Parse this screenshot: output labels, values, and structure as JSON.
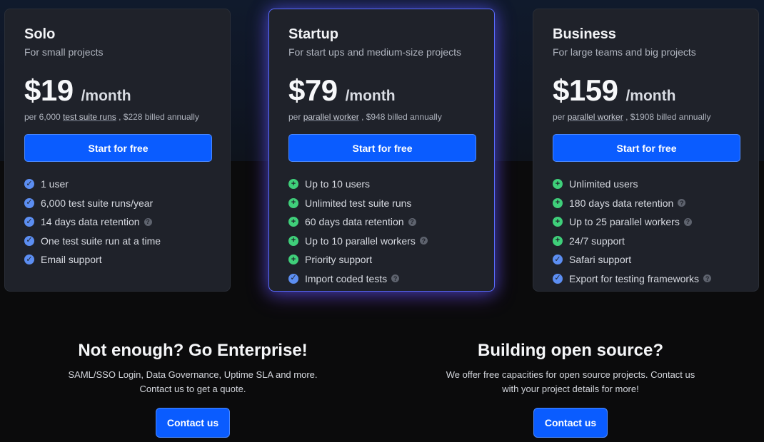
{
  "plans": [
    {
      "name": "Solo",
      "subtitle": "For small projects",
      "price": "$19",
      "per": "/month",
      "billing_prefix": "per 6,000",
      "billing_link": "test suite runs",
      "billing_suffix": ", $228 billed annually",
      "cta": "Start for free",
      "features": [
        {
          "icon": "check-circle-icon",
          "text": "1 user",
          "help": false
        },
        {
          "icon": "check-circle-icon",
          "text": "6,000 test suite runs/year",
          "help": false
        },
        {
          "icon": "check-circle-icon",
          "text": "14 days data retention",
          "help": true
        },
        {
          "icon": "check-circle-icon",
          "text": "One test suite run at a time",
          "help": false
        },
        {
          "icon": "check-circle-icon",
          "text": "Email support",
          "help": false
        }
      ]
    },
    {
      "name": "Startup",
      "subtitle": "For start ups and medium-size projects",
      "price": "$79",
      "per": "/month",
      "billing_prefix": "per",
      "billing_link": "parallel worker",
      "billing_suffix": ", $948 billed annually",
      "cta": "Start for free",
      "features": [
        {
          "icon": "plus-circle-icon",
          "text": "Up to 10 users",
          "help": false
        },
        {
          "icon": "plus-circle-icon",
          "text": "Unlimited test suite runs",
          "help": false
        },
        {
          "icon": "plus-circle-icon",
          "text": "60 days data retention",
          "help": true
        },
        {
          "icon": "plus-circle-icon",
          "text": "Up to 10 parallel workers",
          "help": true
        },
        {
          "icon": "plus-circle-icon",
          "text": "Priority support",
          "help": false
        },
        {
          "icon": "check-circle-icon",
          "text": "Import coded tests",
          "help": true
        }
      ]
    },
    {
      "name": "Business",
      "subtitle": "For large teams and big projects",
      "price": "$159",
      "per": "/month",
      "billing_prefix": "per",
      "billing_link": "parallel worker",
      "billing_suffix": ", $1908 billed annually",
      "cta": "Start for free",
      "features": [
        {
          "icon": "plus-circle-icon",
          "text": "Unlimited users",
          "help": false
        },
        {
          "icon": "plus-circle-icon",
          "text": "180 days data retention",
          "help": true
        },
        {
          "icon": "plus-circle-icon",
          "text": "Up to 25 parallel workers",
          "help": true
        },
        {
          "icon": "plus-circle-icon",
          "text": "24/7 support",
          "help": false
        },
        {
          "icon": "check-circle-icon",
          "text": "Safari support",
          "help": false
        },
        {
          "icon": "check-circle-icon",
          "text": "Export for testing frameworks",
          "help": true
        }
      ]
    }
  ],
  "enterprise": {
    "title": "Not enough? Go Enterprise!",
    "line1": "SAML/SSO Login, Data Governance, Uptime SLA and more.",
    "line2": "Contact us to get a quote.",
    "button": "Contact us"
  },
  "open_source": {
    "title": "Building open source?",
    "line1": "We offer free capacities for open source projects. Contact us",
    "line2": "with your project details for more!",
    "button": "Contact us"
  },
  "colors": {
    "accent": "#0a5cff",
    "check": "#5c8ef2",
    "plus": "#3fcf7a",
    "featured_glow": "#5a6cff"
  }
}
